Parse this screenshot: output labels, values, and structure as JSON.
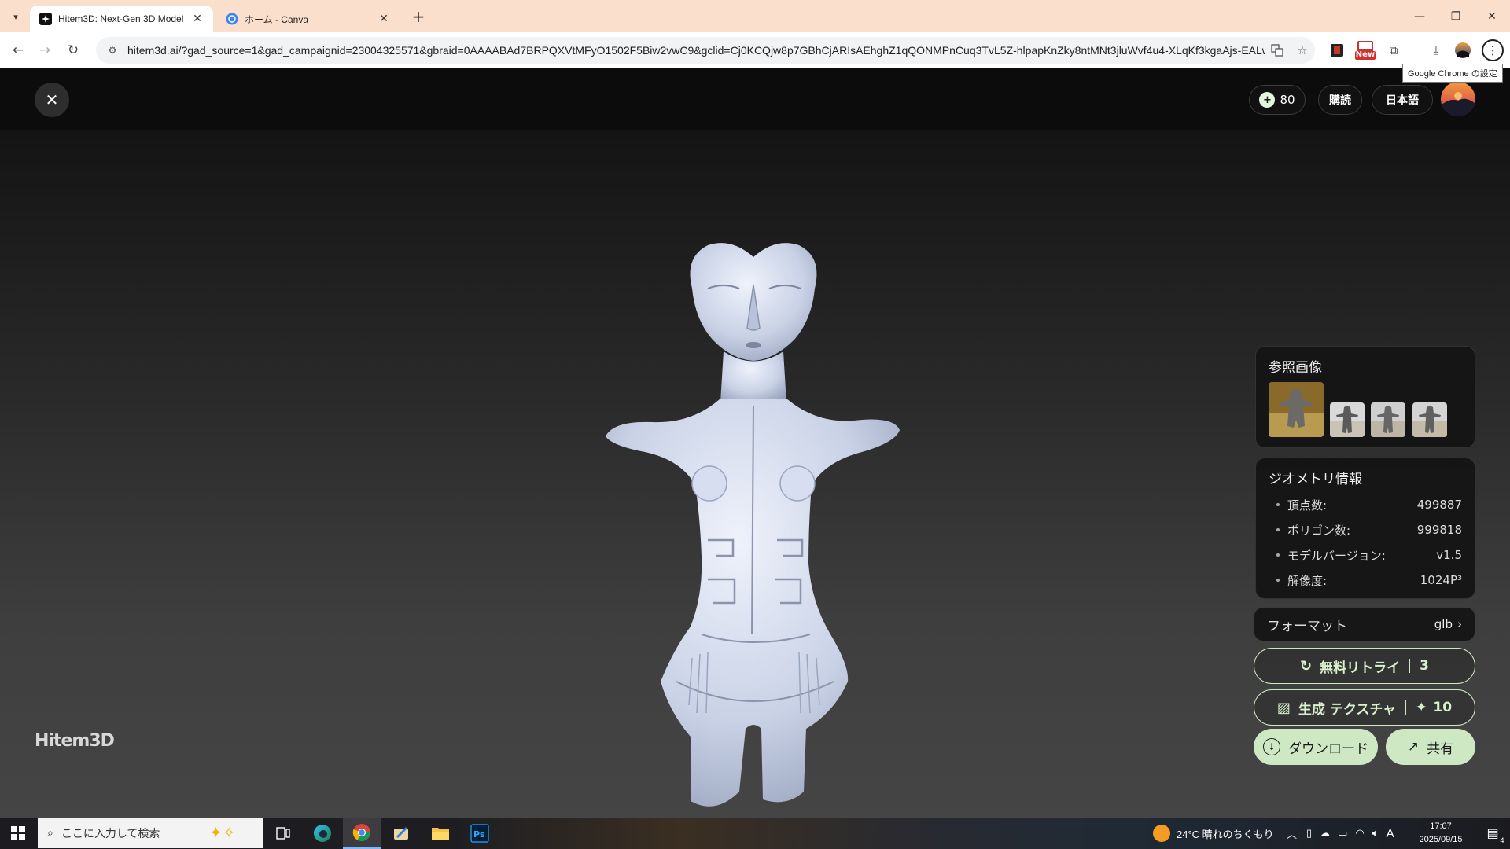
{
  "browser": {
    "tabs": [
      {
        "title": "Hitem3D: Next-Gen 3D Model C",
        "active": true
      },
      {
        "title": "ホーム - Canva",
        "active": false
      }
    ],
    "url": "hitem3d.ai/?gad_source=1&gad_campaignid=23004325571&gbraid=0AAAABAd7BRPQXVtMFyO1502F5Biw2vwC9&gclid=Cj0KCQjw8p7GBhCjARIsAEhghZ1qQONMPnCuq3TvL5Z-hlpapKnZky8ntMNt3jluWvf4u4-XLqKf3kgaAjs-EALw_...",
    "tooltip": "Google Chrome の設定",
    "new_badge": "New"
  },
  "header": {
    "credits": "80",
    "subscribe_label": "購読",
    "language_label": "日本語"
  },
  "watermark": "Hitem3D",
  "reference": {
    "title": "参照画像",
    "thumb_count": 4
  },
  "geometry": {
    "title": "ジオメトリ情報",
    "rows": [
      {
        "label": "頂点数:",
        "value": "499887"
      },
      {
        "label": "ポリゴン数:",
        "value": "999818"
      },
      {
        "label": "モデルバージョン:",
        "value": "v1.5"
      },
      {
        "label": "解像度:",
        "value": "1024P³"
      }
    ]
  },
  "format": {
    "label": "フォーマット",
    "value": "glb"
  },
  "actions": {
    "retry_label": "無料リトライ",
    "retry_count": "3",
    "texture_label": "生成 テクスチャ",
    "texture_cost": "10",
    "download_label": "ダウンロード",
    "share_label": "共有"
  },
  "taskbar": {
    "search_placeholder": "ここに入力して検索",
    "weather": "24°C 晴れのちくもり",
    "ime": "A",
    "time": "17:07",
    "date": "2025/09/15",
    "notification_count": "4"
  },
  "colors": {
    "accent": "#cfe8c4",
    "tab_strip": "#fbdfcd"
  }
}
